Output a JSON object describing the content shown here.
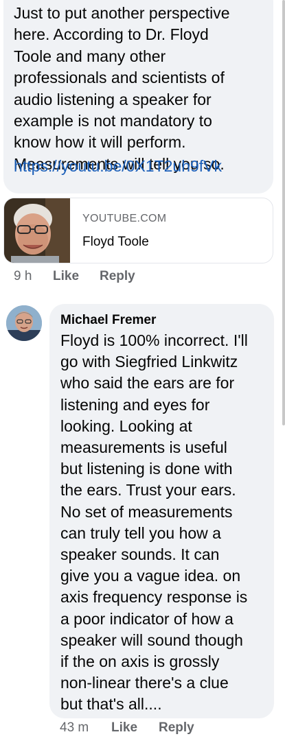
{
  "comment1": {
    "lines": "Just to put another perspective\nhere. According to Dr. Floyd\nToole and many other\nprofessionals and scientists of\naudio listening a speaker for\nexample is not mandatory to\nknow how it will perform.\nMeasurements will tell you so.",
    "link": "https://youtu.be/0X1T2uh9fVk",
    "preview": {
      "domain": "YOUTUBE.COM",
      "title": "Floyd Toole"
    },
    "time": "9 h",
    "like_label": "Like",
    "reply_label": "Reply"
  },
  "comment2": {
    "author": "Michael Fremer",
    "lines": "Floyd is 100% incorrect. I'll\ngo with Siegfried Linkwitz\nwho said the ears are for\nlistening and eyes for\nlooking. Looking at\nmeasurements is useful\nbut listening is done with\nthe ears. Trust your ears.\nNo set of measurements\ncan truly tell you how a\nspeaker sounds. It can\ngive you a vague idea. on\naxis frequency response is\na poor indicator of how a\nspeaker will sound though\nif the on axis is grossly\nnon-linear there's a clue\nbut that's all....",
    "time": "43 m",
    "like_label": "Like",
    "reply_label": "Reply"
  },
  "colors": {
    "bubble": "#f0f2f5",
    "link": "#1a5eb8",
    "meta": "#65676b",
    "text": "#050505"
  }
}
